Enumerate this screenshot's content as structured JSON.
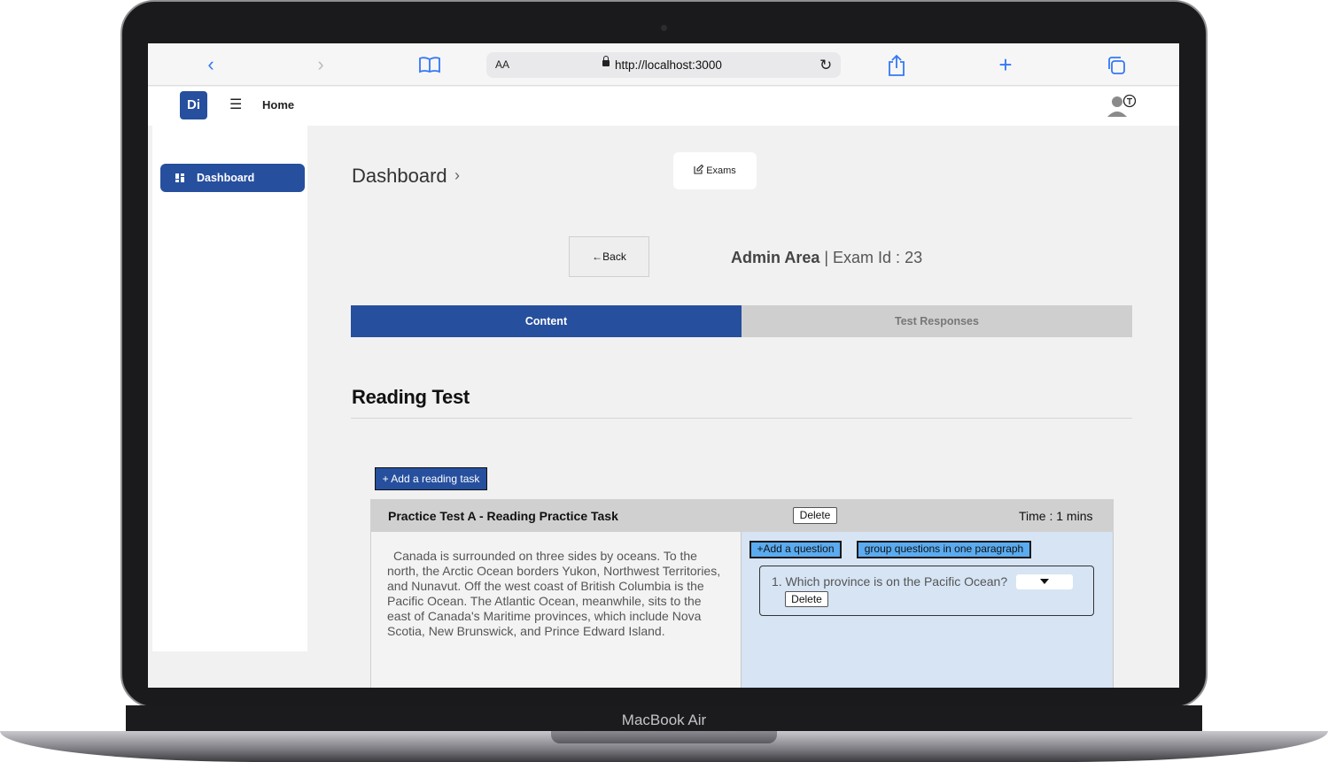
{
  "device": {
    "brand": "MacBook Air"
  },
  "browser": {
    "text_size_label": "AA",
    "url": "http://localhost:3000",
    "icons": [
      "chevron-left-icon",
      "chevron-right-icon",
      "book-icon",
      "reload-icon",
      "share-icon",
      "plus-icon",
      "tabs-icon"
    ]
  },
  "header": {
    "logo_text": "Di",
    "home_label": "Home"
  },
  "sidebar": {
    "items": [
      {
        "label": "Dashboard",
        "icon": "dashboard-grid-icon",
        "active": true
      }
    ]
  },
  "main": {
    "breadcrumb": "Dashboard",
    "exams_button": "Exams",
    "back_button": "Back",
    "admin_area": "Admin Area",
    "exam_id_text": " | Exam Id : 23",
    "tabs": [
      {
        "label": "Content",
        "active": true
      },
      {
        "label": "Test Responses",
        "active": false
      }
    ],
    "section_title": "Reading Test",
    "add_task_button": "+ Add a reading task",
    "task": {
      "title": "Practice Test A - Reading Practice Task",
      "delete_label": "Delete",
      "time": "Time : 1 mins",
      "passage": "Canada is surrounded on three sides by oceans. To the north, the Arctic Ocean borders Yukon, Northwest Territories, and Nunavut. Off the west coast of British Columbia is the Pacific Ocean. The Atlantic Ocean, meanwhile, sits to the east of Canada's Maritime provinces, which include Nova Scotia, New Brunswick, and Prince Edward Island.",
      "add_question_button": "+Add a question",
      "group_button": "group questions in one paragraph",
      "questions": [
        {
          "text": "1. Which province is on the Pacific Ocean?",
          "delete_label": "Delete"
        }
      ]
    }
  },
  "colors": {
    "primary": "#264f9e",
    "accent_button": "#5aabf0",
    "question_panel": "#d6e4f4"
  }
}
